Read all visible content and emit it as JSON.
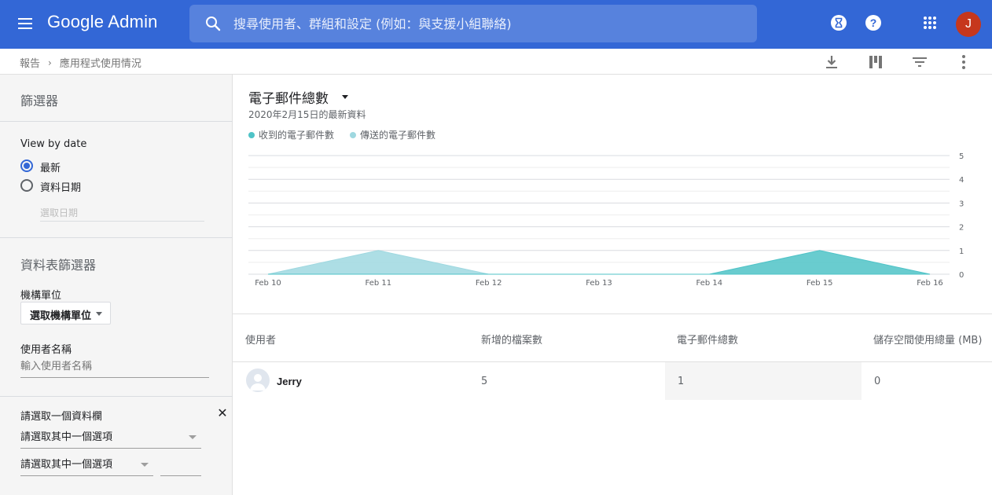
{
  "app": {
    "logo_text": "Google Admin",
    "search_placeholder": "搜尋使用者、群組和設定 (例如：與支援小組聯絡)",
    "avatar_letter": "J",
    "avatar_color": "#c6371c",
    "brand_color": "#3367d6",
    "top_icons": [
      "hourglass-icon",
      "help-icon",
      "apps-grid-icon"
    ]
  },
  "breadcrumb": {
    "items": [
      "報告",
      "應用程式使用情況"
    ],
    "separator": "›",
    "tools": [
      "download-icon",
      "columns-icon",
      "filter-icon",
      "more-vert-icon"
    ]
  },
  "filters": {
    "title": "篩選器",
    "view_by_date_label": "View by date",
    "option_latest": "最新",
    "option_data_date": "資料日期",
    "selected_option": "最新",
    "date_placeholder": "選取日期",
    "table_filters_title": "資料表篩選器",
    "org_unit_label": "機構單位",
    "org_unit_button": "選取機構單位",
    "user_name_label": "使用者名稱",
    "user_name_placeholder": "輸入使用者名稱",
    "column_select_label": "請選取一個資料欄",
    "select_option_1": "請選取其中一個選項",
    "select_option_2": "請選取其中一個選項"
  },
  "chart_header": {
    "title": "電子郵件總數",
    "subtitle": "2020年2月15日的最新資料"
  },
  "chart_data": {
    "type": "area",
    "x": [
      "Feb 10",
      "Feb 11",
      "Feb 12",
      "Feb 13",
      "Feb 14",
      "Feb 15",
      "Feb 16"
    ],
    "ylim": [
      0,
      5
    ],
    "yticks": [
      0,
      1,
      2,
      3,
      4,
      5
    ],
    "grid": true,
    "legend_position": "top-left",
    "series": [
      {
        "name": "收到的電子郵件數",
        "values": [
          0,
          0,
          0,
          0,
          0,
          1,
          0
        ],
        "color": "#4fc3c7"
      },
      {
        "name": "傳送的電子郵件數",
        "values": [
          0,
          1,
          0,
          0,
          0,
          0,
          0
        ],
        "color": "#9fd8e0"
      }
    ]
  },
  "table": {
    "columns": [
      "使用者",
      "新增的檔案數",
      "電子郵件總數",
      "儲存空間使用總量 (MB)"
    ],
    "rows": [
      {
        "user": "Jerry",
        "files_added": "5",
        "emails_total": "1",
        "storage": "0"
      }
    ]
  }
}
